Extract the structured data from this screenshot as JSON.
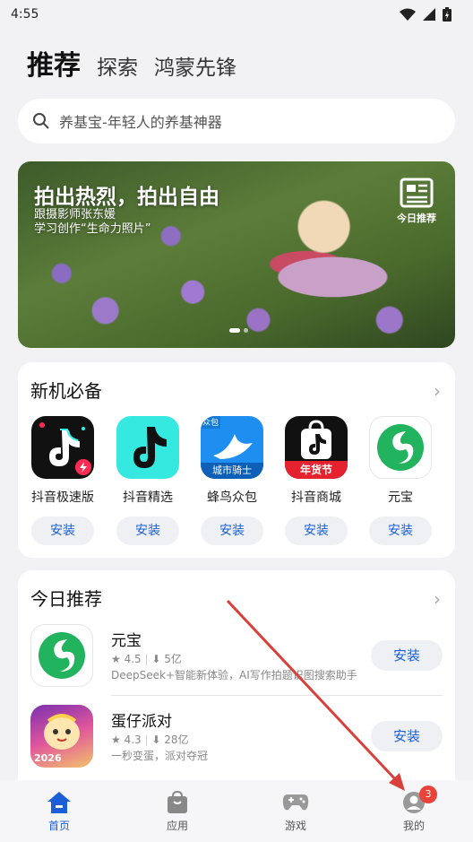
{
  "status_bar": {
    "time": "4:55"
  },
  "top_tabs": [
    "推荐",
    "探索",
    "鸿蒙先锋"
  ],
  "search": {
    "placeholder": "养基宝-年轻人的养基神器"
  },
  "banner": {
    "title": "拍出热烈，拍出自由",
    "subtitle_line1": "跟摄影师张东媛",
    "subtitle_line2": "学习创作“生命力照片”",
    "badge": "今日推荐"
  },
  "new_essentials": {
    "title": "新机必备",
    "apps": [
      {
        "name": "抖音极速版",
        "install": "安装",
        "icon": "douyin-lite-icon"
      },
      {
        "name": "抖音精选",
        "install": "安装",
        "icon": "douyin-jingxuan-icon"
      },
      {
        "name": "蜂鸟众包",
        "install": "安装",
        "icon": "fengniao-icon",
        "icon_label": "城市骑士",
        "icon_tag": "众包"
      },
      {
        "name": "抖音商城",
        "install": "安装",
        "icon": "douyin-mall-icon",
        "icon_label": "年货节"
      },
      {
        "name": "元宝",
        "install": "安装",
        "icon": "yuanbao-icon"
      }
    ]
  },
  "today": {
    "title": "今日推荐",
    "apps": [
      {
        "name": "元宝",
        "rating": "4.5",
        "downloads": "5亿",
        "desc": "DeepSeek+智能新体验，AI写作拍题识图搜索助手",
        "install": "安装"
      },
      {
        "name": "蛋仔派对",
        "rating": "4.3",
        "downloads": "28亿",
        "desc": "一秒变蛋，派对夺冠",
        "install": "安装",
        "icon_text": "2026"
      }
    ]
  },
  "bottom_nav": {
    "items": [
      {
        "label": "首页",
        "active": true
      },
      {
        "label": "应用",
        "active": false
      },
      {
        "label": "游戏",
        "active": false
      },
      {
        "label": "我的",
        "active": false,
        "badge": "3"
      }
    ]
  },
  "colors": {
    "accent": "#1a5fd8",
    "badge": "#e8443a",
    "annotation_arrow": "#d9403a"
  }
}
